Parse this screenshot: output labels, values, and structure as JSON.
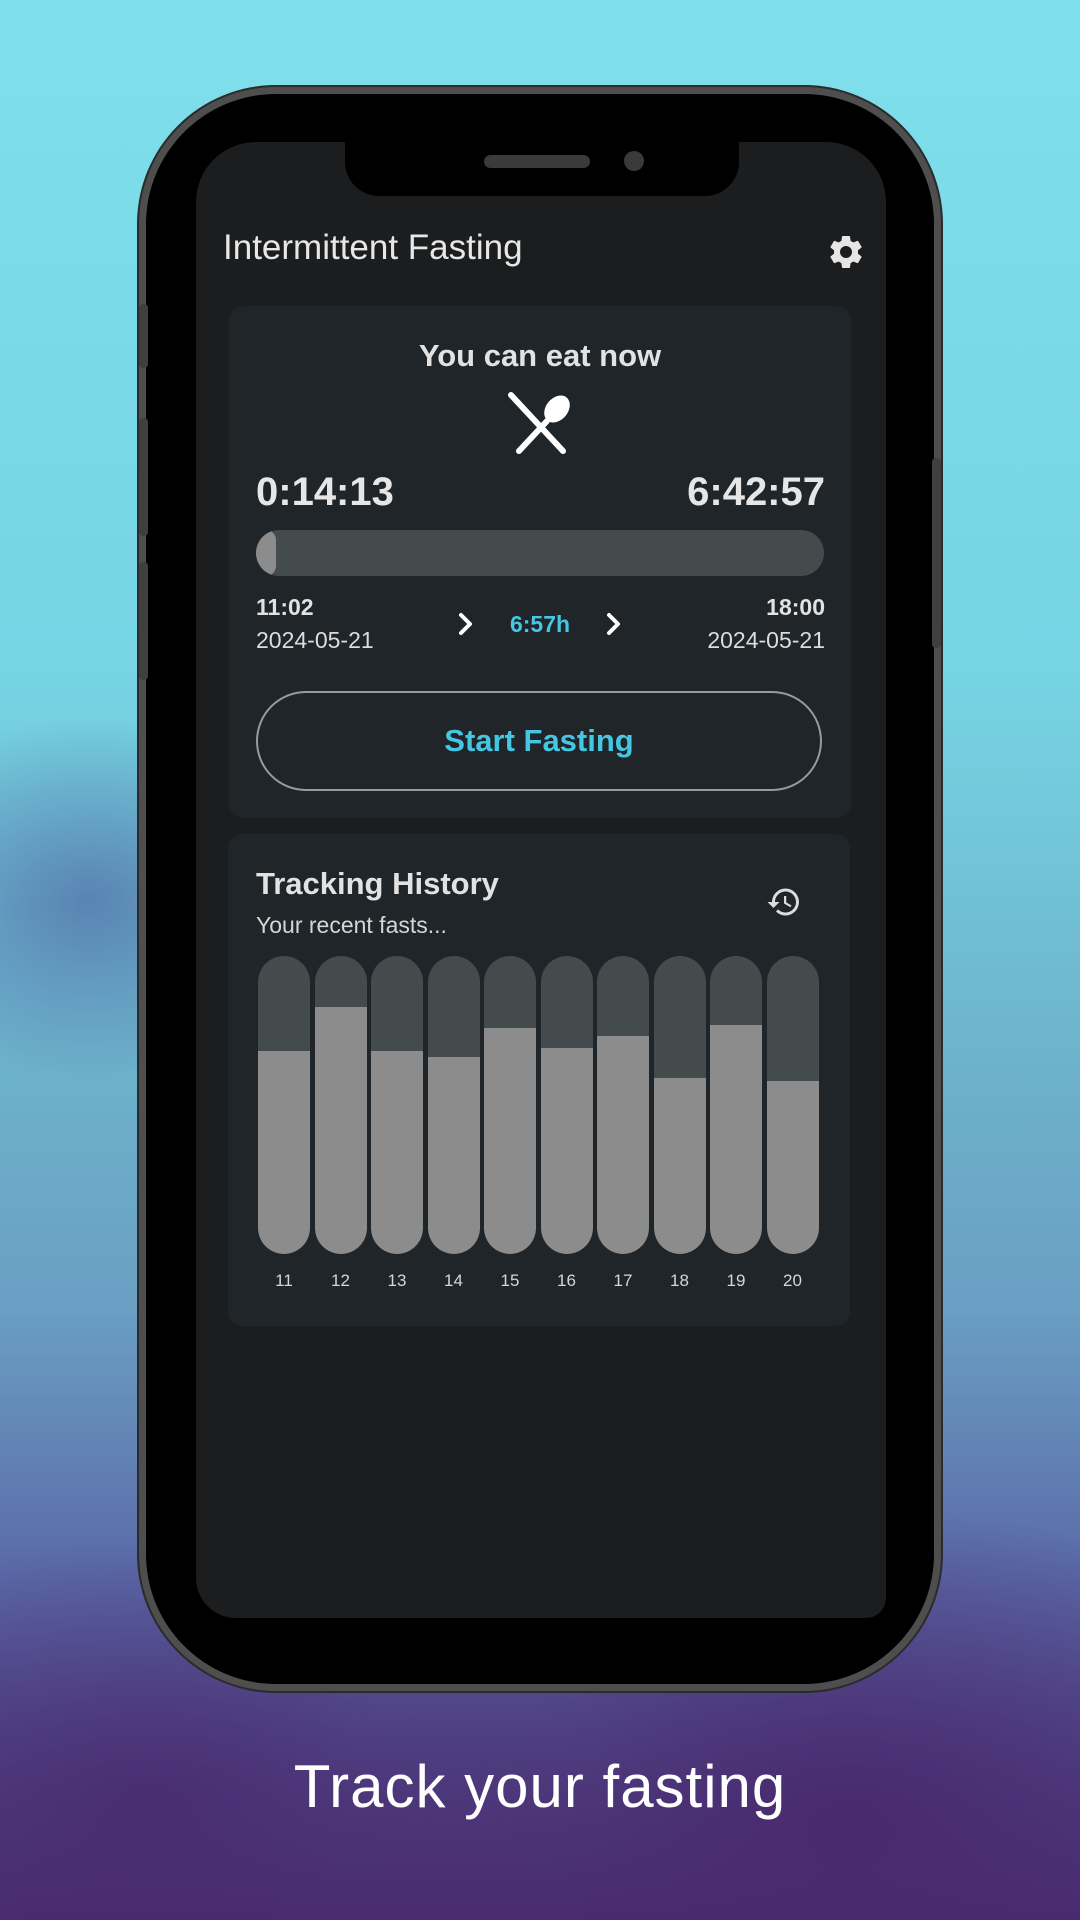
{
  "app": {
    "title": "Intermittent Fasting"
  },
  "status": {
    "message": "You can eat now",
    "elapsed": "0:14:13",
    "remaining": "6:42:57",
    "progress_fraction": 0.035,
    "start_time": "11:02",
    "start_date": "2024-05-21",
    "end_time": "18:00",
    "end_date": "2024-05-21",
    "duration": "6:57h",
    "start_button_label": "Start Fasting"
  },
  "history": {
    "title": "Tracking History",
    "subtitle": "Your recent fasts...",
    "days": [
      "11",
      "12",
      "13",
      "14",
      "15",
      "16",
      "17",
      "18",
      "19",
      "20"
    ],
    "fill_fractions": [
      0.68,
      0.83,
      0.68,
      0.66,
      0.76,
      0.69,
      0.73,
      0.59,
      0.77,
      0.58
    ]
  },
  "icons": {
    "settings": "gear-icon",
    "eat": "fork-spoon-icon",
    "history": "history-icon",
    "chevron": "chevron-right-icon"
  },
  "colors": {
    "accent": "#45c7e3",
    "card": "#1f2528",
    "screen": "#1b1d1e"
  },
  "caption": "Track your fasting"
}
